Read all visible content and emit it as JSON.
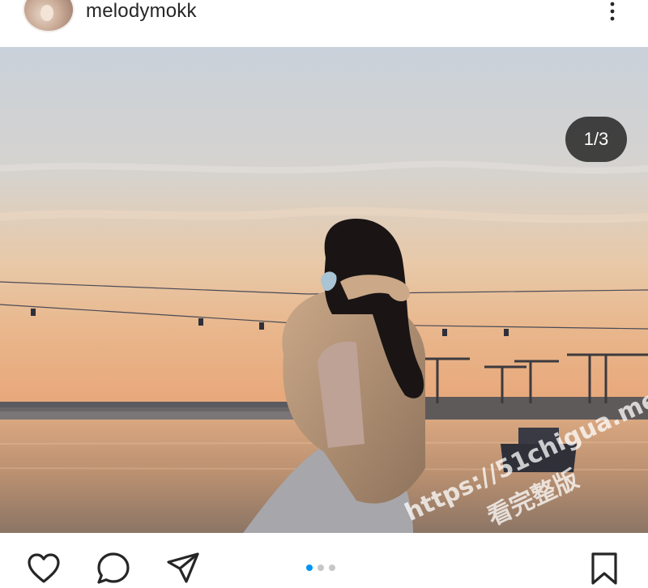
{
  "post": {
    "username": "melodymokk",
    "image_counter": "1/3",
    "carousel": {
      "total": 3,
      "active_index": 0
    }
  },
  "watermark": {
    "url": "https://51chigua.me",
    "label": "看完整版"
  },
  "icons": {
    "more": "more-vertical-icon",
    "like": "heart-icon",
    "comment": "comment-icon",
    "share": "send-icon",
    "save": "bookmark-icon"
  },
  "colors": {
    "accent": "#0095f6",
    "text": "#262626",
    "counter_bg": "#262626"
  }
}
